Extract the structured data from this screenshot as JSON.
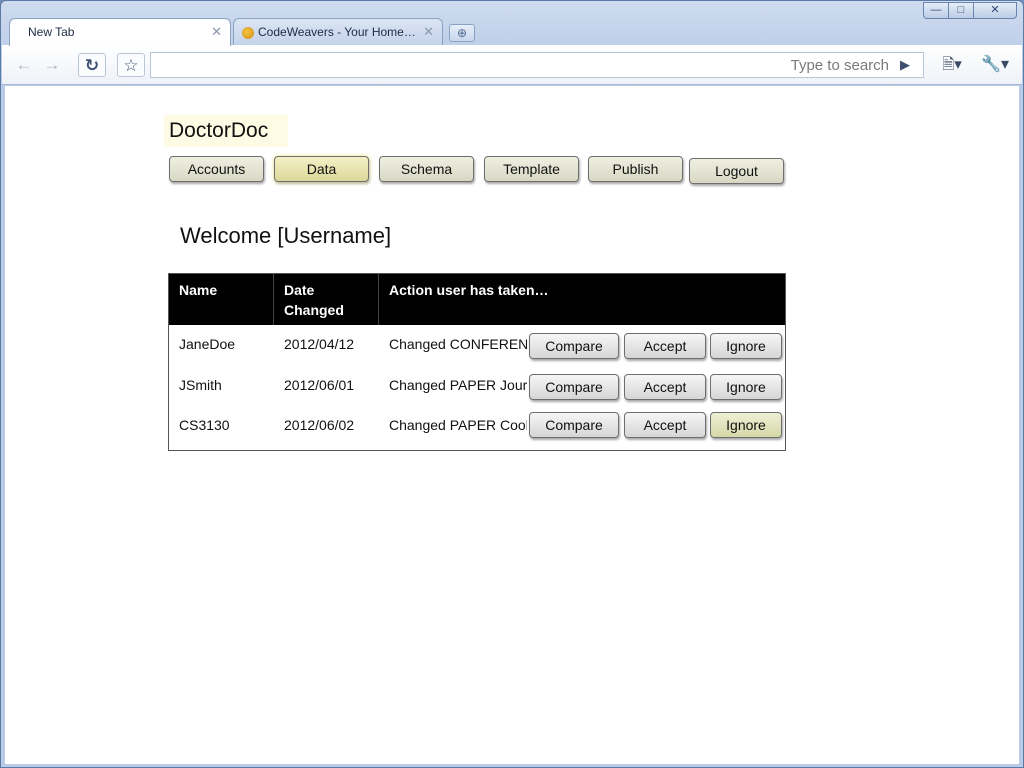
{
  "browser": {
    "tabs": [
      {
        "label": "New Tab",
        "active": true
      },
      {
        "label": "CodeWeavers - Your Home…",
        "active": false
      }
    ],
    "omnibox": {
      "value": "",
      "placeholder": "Type to search"
    },
    "icons": {
      "back": "back-arrow-icon",
      "forward": "forward-arrow-icon",
      "reload": "reload-icon",
      "bookmark": "star-icon",
      "page": "page-menu-icon",
      "wrench": "wrench-menu-icon"
    }
  },
  "app": {
    "brand": "DoctorDoc",
    "nav": [
      {
        "label": "Accounts",
        "active": false
      },
      {
        "label": "Data",
        "active": true
      },
      {
        "label": "Schema",
        "active": false
      },
      {
        "label": "Template",
        "active": false
      },
      {
        "label": "Publish",
        "active": false
      },
      {
        "label": "Logout",
        "active": false
      }
    ],
    "welcome": "Welcome [Username]",
    "table": {
      "headers": [
        "Name",
        "Date Changed",
        "Action user has taken…"
      ],
      "rows": [
        {
          "name": "JaneDoe",
          "date": "2012/04/12",
          "action": "Changed CONFERENCE"
        },
        {
          "name": "JSmith",
          "date": "2012/06/01",
          "action": "Changed PAPER Journal"
        },
        {
          "name": "CS3130",
          "date": "2012/06/02",
          "action": "Changed PAPER Cook"
        }
      ],
      "row_buttons": {
        "compare": "Compare",
        "accept": "Accept",
        "ignore": "Ignore"
      }
    }
  },
  "colors": {
    "nav_active": "#dcd99a",
    "brand_bg": "#fdfbe3",
    "table_header": "#000000",
    "ignore_highlight": "#d4d8a8"
  }
}
